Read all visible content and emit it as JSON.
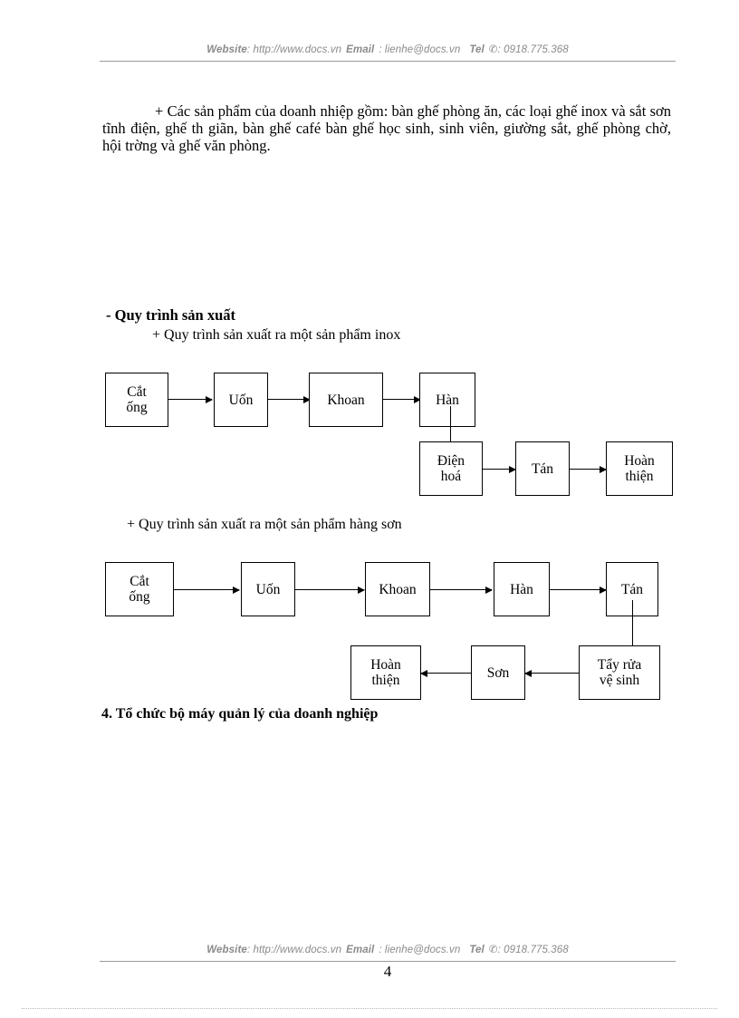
{
  "header": {
    "website_label": "Website",
    "website_value": ": http://www.docs.vn",
    "email_label": "Email",
    "email_value": ": lienhe@docs.vn",
    "tel_label": "Tel",
    "tel_icon": "telephone-icon",
    "tel_value": ": 0918.775.368"
  },
  "footer": {
    "website_label": "Website",
    "website_value": ": http://www.docs.vn",
    "email_label": "Email",
    "email_value": ": lienhe@docs.vn",
    "tel_label": "Tel",
    "tel_icon": "telephone-icon",
    "tel_value": ": 0918.775.368",
    "page_number": "4"
  },
  "body": {
    "products_paragraph": "+ Các sản phẩm của doanh nhiệp gồm: bàn ghế phòng ăn, các loại ghế inox và sắt sơn tĩnh điện, ghế th  giãn, bàn ghế café bàn ghế học sinh, sinh viên, giường  sắt, ghế phòng chờ, hội trờng  và ghế văn phòng.",
    "heading_process": "- Quy trình sản xuất",
    "caption_inox": "+ Quy trình sản xuất ra một sản phẩm inox",
    "caption_hangson": "+ Quy trình sản xuất ra một sản phẩm hàng sơn",
    "heading_section4": "4. Tổ chức bộ máy quản lý của doanh nghiệp"
  },
  "flowchart_inox": {
    "row1": [
      {
        "line1": "Cắt",
        "line2": "ống"
      },
      {
        "line1": "Uốn",
        "line2": ""
      },
      {
        "line1": "Khoan",
        "line2": ""
      },
      {
        "line1": "Hàn",
        "line2": ""
      }
    ],
    "row2": [
      {
        "line1": "Điện",
        "line2": "hoá"
      },
      {
        "line1": "Tán",
        "line2": ""
      },
      {
        "line1": "Hoàn",
        "line2": "thiện"
      }
    ]
  },
  "flowchart_hangson": {
    "row1": [
      {
        "line1": "Cắt",
        "line2": "ống"
      },
      {
        "line1": "Uốn",
        "line2": ""
      },
      {
        "line1": "Khoan",
        "line2": ""
      },
      {
        "line1": "Hàn",
        "line2": ""
      },
      {
        "line1": "Tán",
        "line2": ""
      }
    ],
    "row2": [
      {
        "line1": "Hoàn",
        "line2": "thiện"
      },
      {
        "line1": "Sơn",
        "line2": ""
      },
      {
        "line1": "Tẩy rửa",
        "line2": "vệ sinh"
      }
    ]
  },
  "colors": {
    "page_background": "#ffffff",
    "text": "#000000",
    "runner_text": "#8a8a8a",
    "rule": "#9a9a9a"
  }
}
